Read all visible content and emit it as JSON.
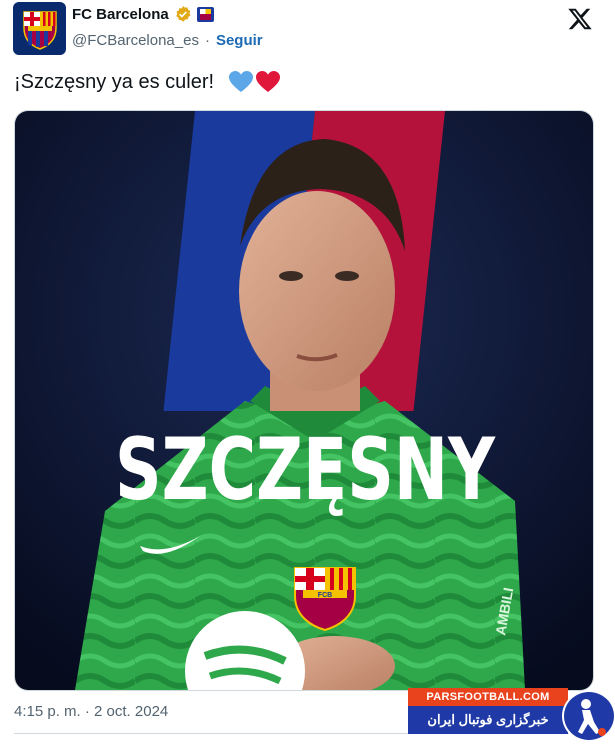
{
  "author": {
    "display_name": "FC Barcelona",
    "handle": "@FCBarcelona_es",
    "follow_label": "Seguir"
  },
  "tweet": {
    "text": "¡Szczęsny ya es culer!",
    "timestamp": "4:15 p. m. · 2 oct. 2024"
  },
  "media": {
    "player_name": "SZCZĘSNY",
    "crest_text": "FCB",
    "sponsor_text": "AMBILI"
  },
  "watermark": {
    "site": "PARSFOOTBALL.COM",
    "tagline": "خبرگزاری فوتبال ایران"
  },
  "colors": {
    "follow": "#1d6bb5",
    "barca_blue": "#1a3a9e",
    "barca_red": "#b5123b",
    "jersey_green": "#2ea84a",
    "heart_blue": "#5ba7e8",
    "heart_red": "#e0163b"
  },
  "icons": {
    "verified": "verified-gold-badge-icon",
    "x_logo": "x-logo-icon",
    "hearts": [
      "blue-heart-icon",
      "red-heart-icon"
    ]
  }
}
